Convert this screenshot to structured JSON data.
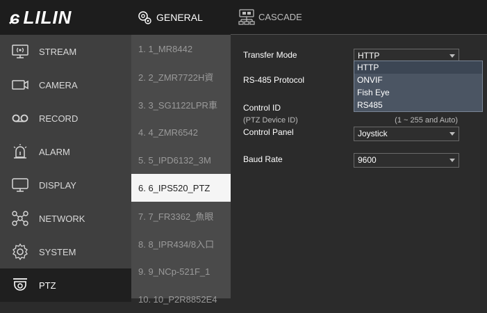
{
  "brand": {
    "logo_text": "LILIN"
  },
  "sidebar": {
    "items": [
      {
        "label": "STREAM",
        "icon": "stream-icon"
      },
      {
        "label": "CAMERA",
        "icon": "camera-icon"
      },
      {
        "label": "RECORD",
        "icon": "record-icon"
      },
      {
        "label": "ALARM",
        "icon": "alarm-icon"
      },
      {
        "label": "DISPLAY",
        "icon": "display-icon"
      },
      {
        "label": "NETWORK",
        "icon": "network-icon"
      },
      {
        "label": "SYSTEM",
        "icon": "system-icon"
      },
      {
        "label": "PTZ",
        "icon": "ptz-icon",
        "active": true
      }
    ]
  },
  "camera_list": {
    "header": "GENERAL",
    "header_icon": "general-icon",
    "items": [
      {
        "label": "1. 1_MR8442"
      },
      {
        "label": "2. 2_ZMR7722H資"
      },
      {
        "label": "3. 3_SG1122LPR車"
      },
      {
        "label": "4. 4_ZMR6542"
      },
      {
        "label": "5. 5_IPD6132_3M"
      },
      {
        "label": "6. 6_IPS520_PTZ",
        "active": true
      },
      {
        "label": "7. 7_FR3362_魚眼"
      },
      {
        "label": "8. 8_IPR434/8入口"
      },
      {
        "label": "9. 9_NCp-521F_1"
      },
      {
        "label": "10. 10_P2R8852E4"
      }
    ]
  },
  "main": {
    "section_title": "CASCADE",
    "section_icon": "cascade-icon",
    "transfer_mode": {
      "label": "Transfer Mode",
      "value": "HTTP"
    },
    "transfer_mode_options": [
      "HTTP",
      "ONVIF",
      "Fish Eye",
      "RS485"
    ],
    "rs485_protocol": {
      "label": "RS-485 Protocol"
    },
    "control_id": {
      "label": "Control ID",
      "sublabel": "(PTZ Device ID)",
      "range": "(1 ~ 255 and Auto)"
    },
    "control_panel": {
      "label": "Control Panel",
      "value": "Joystick"
    },
    "baud_rate": {
      "label": "Baud Rate",
      "value": "9600"
    }
  },
  "colors": {
    "accent_dropdown": "#4b5563",
    "active_item_bg": "#f5f5f5"
  }
}
